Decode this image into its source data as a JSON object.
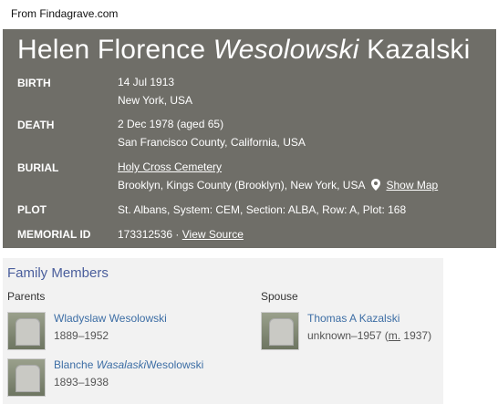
{
  "caption": "From Findagrave.com",
  "memorial": {
    "name_first": "Helen Florence",
    "name_maiden": "Wesolowski",
    "name_last": "Kazalski",
    "birth": {
      "label": "BIRTH",
      "date": "14 Jul 1913",
      "place": "New York, USA"
    },
    "death": {
      "label": "DEATH",
      "date": "2 Dec 1978 (aged 65)",
      "place": "San Francisco County, California, USA"
    },
    "burial": {
      "label": "BURIAL",
      "cemetery": "Holy Cross Cemetery",
      "place": "Brooklyn, Kings County (Brooklyn), New York, USA",
      "show_map": "Show Map"
    },
    "plot": {
      "label": "PLOT",
      "value": "St. Albans, System: CEM, Section: ALBA, Row: A, Plot: 168"
    },
    "memorial_id": {
      "label": "MEMORIAL ID",
      "value": "173312536 ·",
      "view_source": "View Source"
    }
  },
  "family": {
    "title": "Family Members",
    "parents_label": "Parents",
    "spouse_label": "Spouse",
    "parents": [
      {
        "name": "Wladyslaw Wesolowski",
        "dates": "1889–1952"
      },
      {
        "name_first": "Blanche",
        "name_maiden": "Wasalaski",
        "name_last": "Wesolowski",
        "dates": "1893–1938"
      }
    ],
    "spouse": {
      "name": "Thomas A Kazalski",
      "dates_pre": "unknown–1957 (",
      "married_abbr": "m.",
      "dates_post": " 1937)"
    }
  },
  "colors": {
    "header_bg": "#6f6e68",
    "link": "#3d6ea5",
    "section_title": "#4a5e9c"
  },
  "icons": {
    "map_pin": "map-pin-icon"
  }
}
